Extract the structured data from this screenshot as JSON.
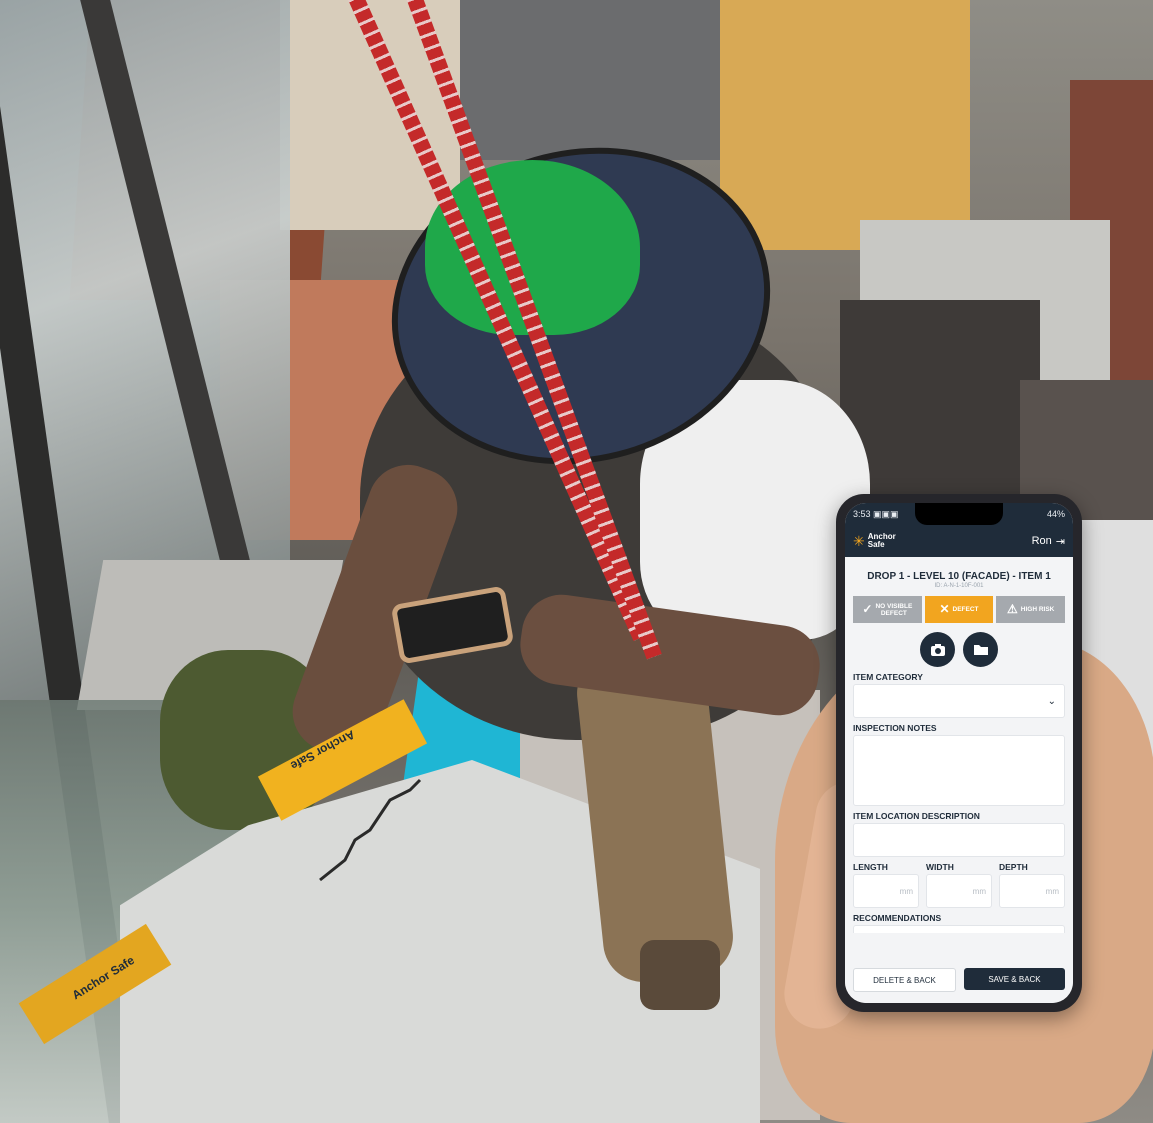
{
  "status_bar": {
    "time": "3:53",
    "icons_left": "▣▣▣",
    "battery": "44%"
  },
  "app": {
    "logo_line1": "Anchor",
    "logo_line2": "Safe",
    "user": "Ron"
  },
  "item": {
    "title": "DROP 1 - LEVEL 10 (FACADE) - ITEM 1",
    "id_text": "ID: A-N-1-10F-001"
  },
  "status_options": [
    {
      "label_line1": "NO VISIBLE",
      "label_line2": "DEFECT",
      "icon": "check-icon"
    },
    {
      "label": "DEFECT",
      "icon": "x-icon",
      "selected": true
    },
    {
      "label": "HIGH RISK",
      "icon": "warning-icon"
    }
  ],
  "fields": {
    "item_category": {
      "label": "ITEM CATEGORY",
      "value": ""
    },
    "inspection_notes": {
      "label": "INSPECTION NOTES",
      "value": ""
    },
    "item_location": {
      "label": "ITEM LOCATION DESCRIPTION",
      "value": ""
    },
    "length": {
      "label": "LENGTH",
      "unit": "mm"
    },
    "width": {
      "label": "WIDTH",
      "unit": "mm"
    },
    "depth": {
      "label": "DEPTH",
      "unit": "mm"
    },
    "recommendations": {
      "label": "RECOMMENDATIONS"
    }
  },
  "actions": {
    "delete": "DELETE & BACK",
    "save": "SAVE & BACK"
  },
  "colors": {
    "navy": "#1f2c3a",
    "accent_orange": "#f2a51f",
    "inactive_gray": "#a5a9ae"
  },
  "ruler_text": {
    "brand_line1": "Anchor",
    "brand_line2": "Safe"
  }
}
